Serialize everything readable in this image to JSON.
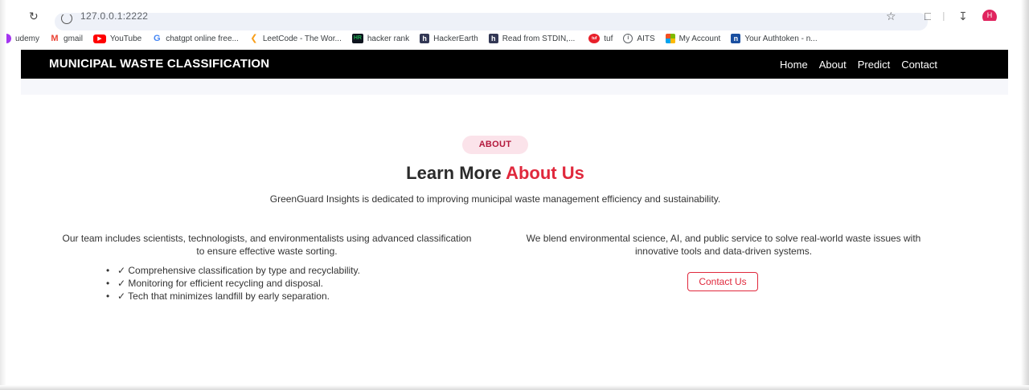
{
  "browser": {
    "url": "127.0.0.1:2222",
    "profile_initial": "H"
  },
  "bookmarks": [
    {
      "label": "udemy",
      "icon": "udemy-icon",
      "color": "#a435f0"
    },
    {
      "label": "gmail",
      "icon": "gmail-icon",
      "color": "#ea4335"
    },
    {
      "label": "YouTube",
      "icon": "youtube-icon",
      "color": "#ff0000"
    },
    {
      "label": "chatgpt online free...",
      "icon": "google-icon",
      "color": "#4285f4"
    },
    {
      "label": "LeetCode - The Wor...",
      "icon": "leetcode-icon",
      "color": "#f89f1b"
    },
    {
      "label": "hacker rank",
      "icon": "hackerrank-icon",
      "color": "#1ba94c"
    },
    {
      "label": "HackerEarth",
      "icon": "hackerearth-icon",
      "color": "#323754"
    },
    {
      "label": "Read from STDIN,...",
      "icon": "hackerearth-icon",
      "color": "#323754"
    },
    {
      "label": "tuf",
      "icon": "tuf-icon",
      "color": "#e8202a"
    },
    {
      "label": "AITS",
      "icon": "aits-icon",
      "color": "#5f6368"
    },
    {
      "label": "My Account",
      "icon": "microsoft-icon",
      "color": "#f25022"
    },
    {
      "label": "Your Authtoken - n...",
      "icon": "ngrok-icon",
      "color": "#1f1e37"
    }
  ],
  "navbar": {
    "brand": "MUNICIPAL WASTE CLASSIFICATION",
    "links": [
      "Home",
      "About",
      "Predict",
      "Contact"
    ]
  },
  "about": {
    "badge": "ABOUT",
    "heading_prefix": "Learn More ",
    "heading_accent": "About Us",
    "lead": "GreenGuard Insights is dedicated to improving municipal waste management efficiency and sustainability.",
    "left_text": "Our team includes scientists, technologists, and environmentalists using advanced classification to ensure effective waste sorting.",
    "features": [
      "✓ Comprehensive classification by type and recyclability.",
      "✓ Monitoring for efficient recycling and disposal.",
      "✓ Tech that minimizes landfill by early separation."
    ],
    "right_text": "We blend environmental science, AI, and public service to solve real-world waste issues with innovative tools and data-driven systems.",
    "contact_button": "Contact Us"
  },
  "colors": {
    "accent": "#e0283c",
    "navbar_bg": "#000000",
    "badge_bg": "#fbe3ea"
  }
}
